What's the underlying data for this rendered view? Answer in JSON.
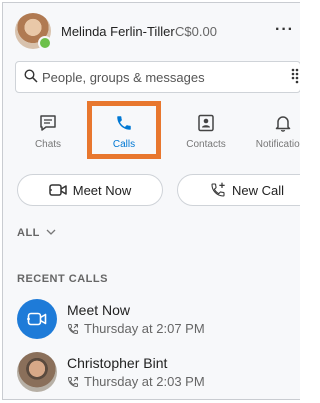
{
  "header": {
    "user_name": "Melinda Ferlin-Tiller",
    "credit": "C$0.00",
    "more_label": "···"
  },
  "search": {
    "placeholder": "People, groups & messages"
  },
  "tabs": [
    {
      "label": "Chats",
      "icon": "chat-icon"
    },
    {
      "label": "Calls",
      "icon": "phone-icon",
      "selected": true
    },
    {
      "label": "Contacts",
      "icon": "contacts-icon"
    },
    {
      "label": "Notifications",
      "icon": "bell-icon"
    }
  ],
  "actions": {
    "meet_now": "Meet Now",
    "new_call": "New Call"
  },
  "filter": {
    "label": "ALL"
  },
  "recent": {
    "title": "RECENT CALLS",
    "items": [
      {
        "name": "Meet Now",
        "time": "Thursday at 2:07 PM"
      },
      {
        "name": "Christopher Bint",
        "time": "Thursday at 2:03 PM"
      }
    ]
  },
  "colors": {
    "accent": "#0078d4",
    "highlight": "#e8772e",
    "presence": "#6cc04a"
  }
}
